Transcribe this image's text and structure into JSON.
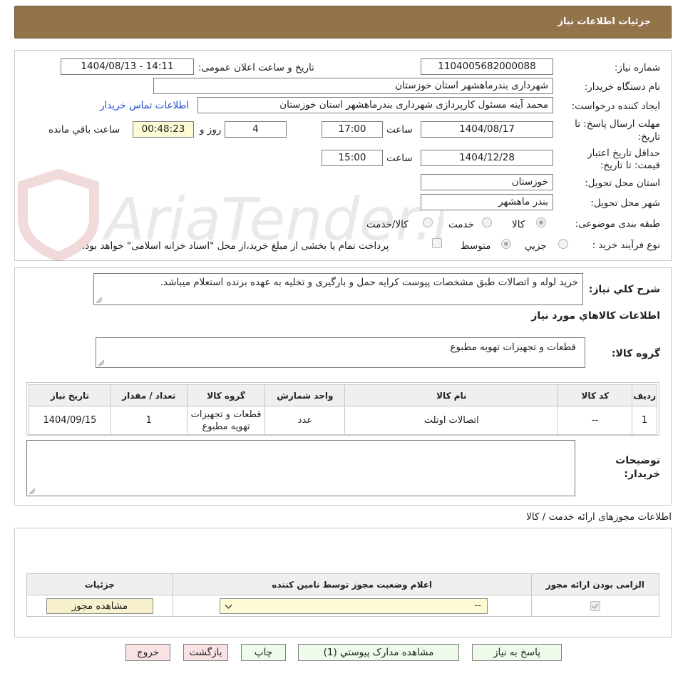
{
  "page_title": "جزئیات اطلاعات نیاز",
  "watermark_text": "AriaTender.neT",
  "form": {
    "need_number_label": "شماره نیاز:",
    "need_number": "1104005682000088",
    "announce_label": "تاریخ و ساعت اعلان عمومی:",
    "announce_value": "1404/08/13 - 14:11",
    "buyer_org_label": "نام دستگاه خریدار:",
    "buyer_org": "شهرداری بندرماهشهر استان خوزستان",
    "creator_label": "ایجاد کننده درخواست:",
    "creator": "محمد آینه مسئول کارپردازی شهرداری بندرماهشهر استان خوزستان",
    "buyer_contact_link": "اطلاعات تماس خریدار",
    "reply_deadline_label_1": "مهلت ارسال پاسخ: تا",
    "reply_deadline_label_2": "تاریخ:",
    "reply_date": "1404/08/17",
    "time_label": "ساعت",
    "reply_time": "17:00",
    "days_value": "4",
    "days_label": "روز و",
    "remaining_time": "00:48:23",
    "remaining_label": "ساعت باقي مانده",
    "price_validity_label_1": "حداقل تاریخ اعتبار",
    "price_validity_label_2": "قیمت: تا تاریخ:",
    "validity_date": "1404/12/28",
    "validity_time": "15:00",
    "province_label": "استان محل تحویل:",
    "province": "خوزستان",
    "city_label": "شهر محل تحویل:",
    "city": "بندر ماهشهر",
    "category_label": "طبقه بندی موضوعی:",
    "category_options": [
      "کالا",
      "خدمت",
      "کالا/خدمت"
    ],
    "purchase_type_label": "نوع فرآیند خرید :",
    "purchase_type_options": [
      "جزیي",
      "متوسط"
    ],
    "payment_note": "پرداخت تمام یا بخشی از مبلغ خرید،از محل \"اسناد خزانه اسلامی\" خواهد بود."
  },
  "description": {
    "label": "شرح کلي نیاز:",
    "text": "خرید لوله و اتصالات طبق مشخصات پیوست کرایه حمل و بارگیری و تخلیه به عهده برنده استعلام میباشد."
  },
  "goods_section_title": "اطلاعات کالاهاي مورد نیاز",
  "goods_group": {
    "label": "گروه کالا:",
    "value": "قطعات و تجهیزات تهویه مطبوع"
  },
  "goods_table": {
    "headers": [
      "ردیف",
      "کد کالا",
      "نام کالا",
      "واحد شمارش",
      "گروه کالا",
      "تعداد / مقدار",
      "تاریخ نیاز"
    ],
    "rows": [
      [
        "1",
        "--",
        "اتصالات اوتلت",
        "عدد",
        "قطعات و تجهیزات تهویه مطبوع",
        "1",
        "1404/09/15"
      ]
    ]
  },
  "buyer_notes": {
    "label_1": "توضیحات",
    "label_2": "خریدار:"
  },
  "permits": {
    "title": "اطلاعات مجوزهای ارائه خدمت / کالا",
    "headers": [
      "الزامی بودن ارائه مجوز",
      "اعلام وضعیت مجوز توسط نامین کننده",
      "جزئیات"
    ],
    "select_value": "--",
    "view_button": "مشاهده مجوز"
  },
  "footer_buttons": {
    "reply": "پاسخ به نیاز",
    "attachments": "مشاهده مدارک پیوستي (1)",
    "print": "چاپ",
    "back": "بازگشت",
    "exit": "خروج"
  },
  "colors": {
    "title_bar": "#93734a",
    "link": "#1f4fd1",
    "timer_bg": "#fdfbd4"
  }
}
